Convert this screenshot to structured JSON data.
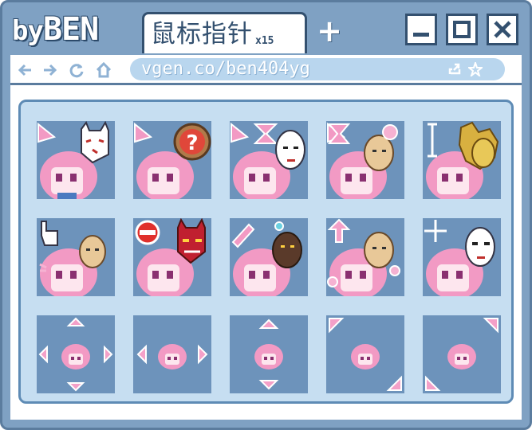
{
  "window": {
    "brand_prefix": "by",
    "brand_name": "BEN",
    "tab_label": "鼠标指针",
    "tab_count": "x15",
    "new_tab_symbol": "+",
    "buttons": [
      "minimize",
      "maximize",
      "close"
    ]
  },
  "urlbar": {
    "url": "vgen.co/ben404yg",
    "nav_icons": [
      "back-arrow-icon",
      "forward-arrow-icon",
      "refresh-icon",
      "home-icon"
    ],
    "actions": [
      "share-icon",
      "bookmark-star-icon"
    ]
  },
  "cursors": [
    {
      "name": "normal-select",
      "overlay": "kitsune-mask"
    },
    {
      "name": "help-select",
      "overlay": "question-mark"
    },
    {
      "name": "working-in-background",
      "overlay": "hourglass-noh-mask"
    },
    {
      "name": "busy",
      "overlay": "hourglass-okame-mask"
    },
    {
      "name": "text-select",
      "overlay": "i-beam-golden-mask"
    },
    {
      "name": "link-select",
      "overlay": "pointing-hand-mask"
    },
    {
      "name": "unavailable",
      "overlay": "no-symbol-oni-mask"
    },
    {
      "name": "handwriting",
      "overlay": "pen-tengu-mask"
    },
    {
      "name": "vertical-resize",
      "overlay": "up-arrow-okame-mask"
    },
    {
      "name": "precision-select",
      "overlay": "crosshair-white-mask"
    },
    {
      "name": "move",
      "overlay": "four-arrows"
    },
    {
      "name": "horizontal-resize",
      "overlay": "left-right-arrows"
    },
    {
      "name": "vertical-resize-arrows",
      "overlay": "up-down-arrows"
    },
    {
      "name": "diagonal-resize-1",
      "overlay": "nw-se-arrows"
    },
    {
      "name": "diagonal-resize-2",
      "overlay": "ne-sw-arrows"
    }
  ],
  "colors": {
    "frame": "#7fa1c3",
    "frame_dark": "#33506f",
    "panel": "#c6def1",
    "cell": "#6d93bb",
    "hair": "#f29ac4",
    "arrow": "#f4a0c8"
  }
}
